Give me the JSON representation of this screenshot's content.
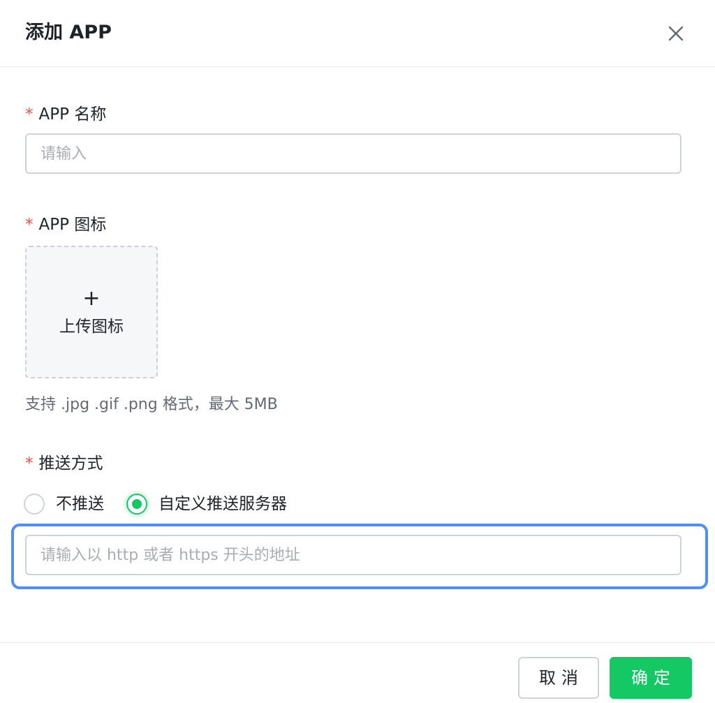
{
  "dialog": {
    "title": "添加 APP"
  },
  "form": {
    "required_mark": "*",
    "app_name": {
      "label": "APP 名称",
      "placeholder": "请输入",
      "value": ""
    },
    "app_icon": {
      "label": "APP 图标",
      "upload_plus": "+",
      "upload_text": "上传图标",
      "hint": "支持 .jpg .gif .png 格式，最大 5MB"
    },
    "push_method": {
      "label": "推送方式",
      "options": [
        {
          "label": "不推送",
          "checked": false
        },
        {
          "label": "自定义推送服务器",
          "checked": true
        }
      ],
      "server_url": {
        "placeholder": "请输入以 http 或者 https 开头的地址",
        "value": ""
      }
    }
  },
  "footer": {
    "cancel_label": "取消",
    "ok_label": "确定"
  },
  "colors": {
    "primary": "#14c864",
    "required": "#f54a45",
    "focus": "#4e8ef5"
  }
}
